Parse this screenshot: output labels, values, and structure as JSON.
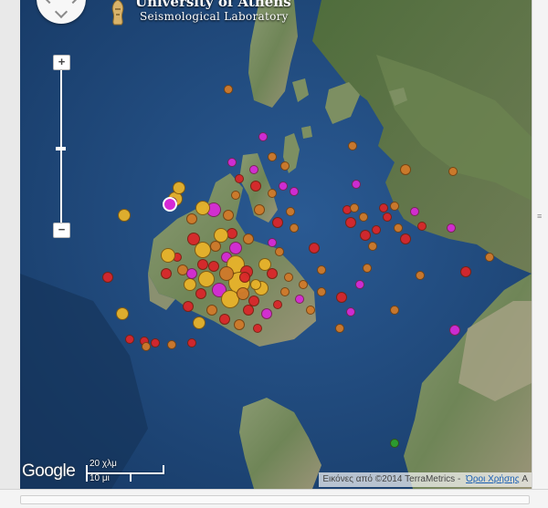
{
  "header": {
    "title": "University of Athens",
    "subtitle": "Seismological Laboratory"
  },
  "controls": {
    "zoom_in_label": "+",
    "zoom_out_label": "−"
  },
  "branding": {
    "logo_text": "Google"
  },
  "scale": {
    "upper_label": "20 χλμ",
    "lower_label": "10 μι"
  },
  "attribution": {
    "imagery_text": "Εικόνες από ©2014 TerraMetrics",
    "separator": "-",
    "terms_link": "Όροι Χρήσης",
    "trailing": "A"
  },
  "legend_colors": {
    "red": "#d9262a",
    "orange": "#d07a2a",
    "yellow": "#e8b32a",
    "magenta": "#d62ad6",
    "green": "#2ca02c"
  },
  "earthquake_markers": {
    "red": 42,
    "orange": 38,
    "yellow": 24,
    "magenta": 26,
    "green": 1,
    "highlighted": 1
  }
}
